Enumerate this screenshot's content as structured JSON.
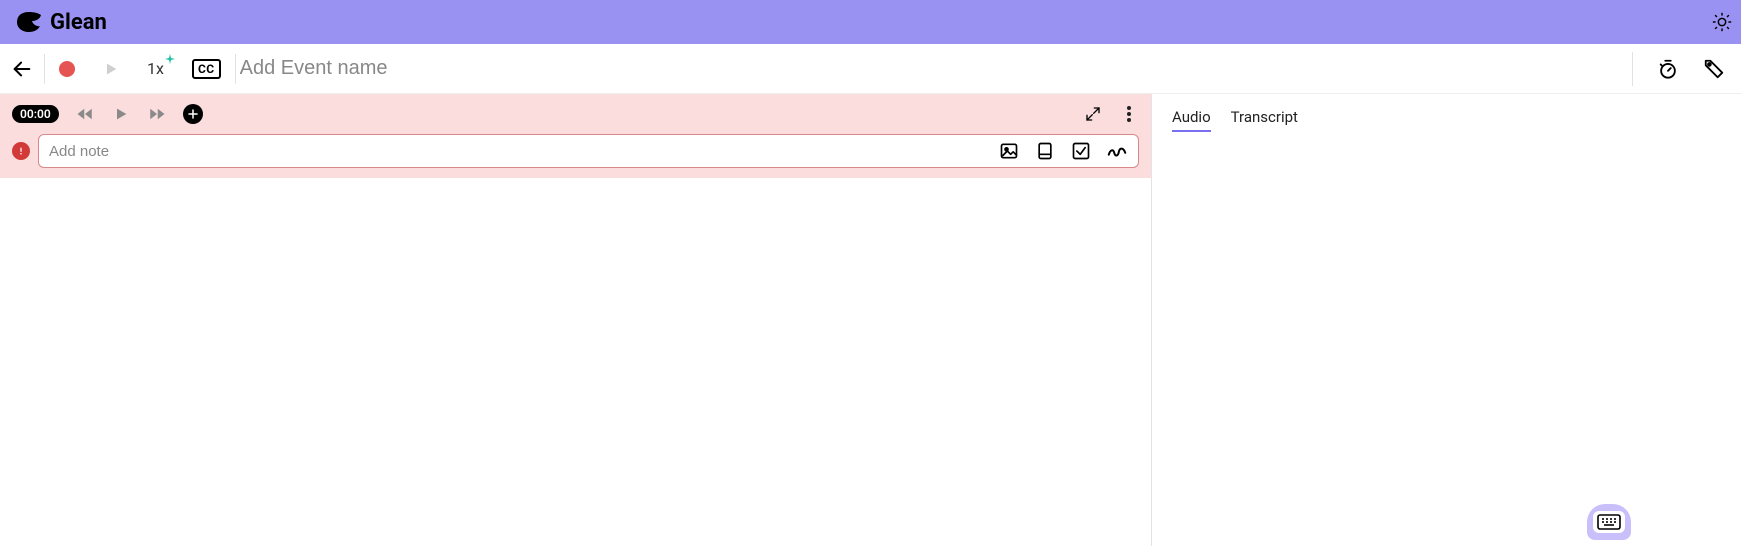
{
  "brand": "Glean",
  "toolbar": {
    "event_name_value": "",
    "event_name_placeholder": "Add Event name",
    "speed_label": "1x",
    "cc_label": "CC"
  },
  "player": {
    "time": "00:00"
  },
  "note": {
    "placeholder": "Add note",
    "value": ""
  },
  "side": {
    "tabs": [
      {
        "label": "Audio",
        "active": true
      },
      {
        "label": "Transcript",
        "active": false
      }
    ]
  }
}
